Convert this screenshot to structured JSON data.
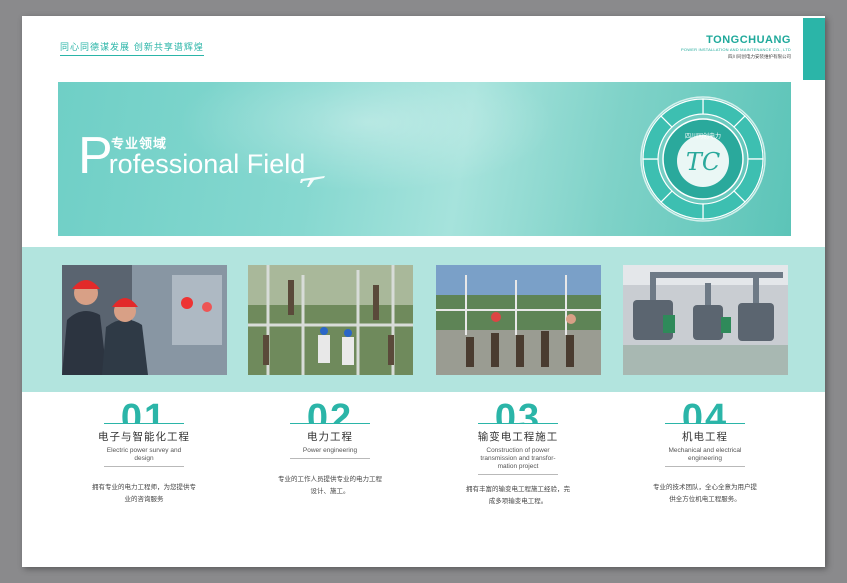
{
  "header": {
    "slogan": "同心同德谋发展  创新共享谱辉煌",
    "brand_name": "TONGCHUANG",
    "brand_subtitle": "POWER INSTALLATION AND MAINTENANCE CO., LTD",
    "brand_cn": "四川同创电力安装维护有限公司"
  },
  "banner": {
    "title_cn": "专业领域",
    "title_en_initial": "P",
    "title_en_rest": "rofessional Field",
    "emblem_center": "TC",
    "emblem_top": "四川同创电力"
  },
  "colors": {
    "accent": "#2bb5a8",
    "band": "#b2e4de",
    "page": "#ffffff",
    "backdrop": "#8a8a8c"
  },
  "fields": [
    {
      "number": "01",
      "title": "电子与智能化工程",
      "subtitle_en": "Electric power survey and design",
      "description": "拥有专业的电力工程师，为您提供专业的咨询服务"
    },
    {
      "number": "02",
      "title": "电力工程",
      "subtitle_en": "Power engineering",
      "description": "专业的工作人员提供专业的电力工程设计、施工。"
    },
    {
      "number": "03",
      "title": "输变电工程施工",
      "subtitle_en": "Construction of power transmission and transfor-mation project",
      "description": "拥有丰富的输变电工程施工经验，完成多项输变电工程。"
    },
    {
      "number": "04",
      "title": "机电工程",
      "subtitle_en": "Mechanical and electrical engineering",
      "description": "专业的技术团队，全心全意为用户提供全方位机电工程服务。"
    }
  ]
}
